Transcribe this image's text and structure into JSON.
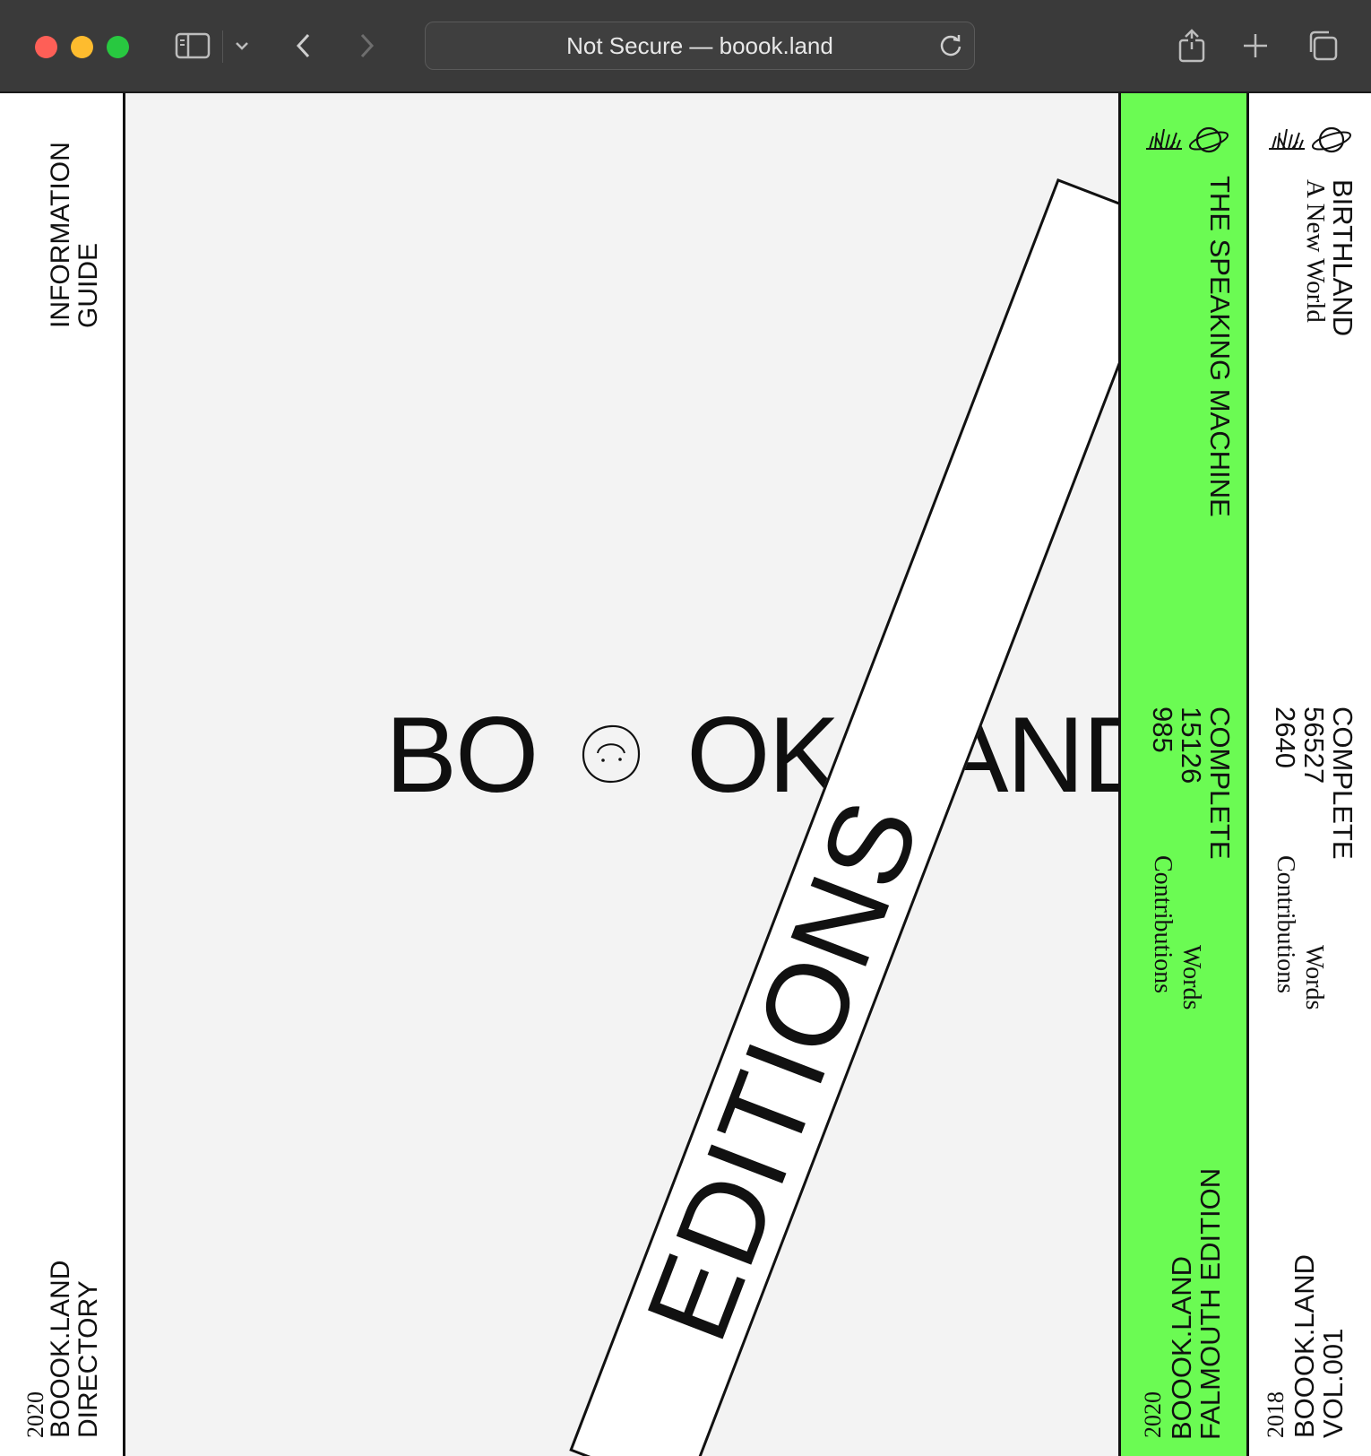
{
  "browser": {
    "url_text": "Not Secure — boook.land"
  },
  "left_panel": {
    "top_text": "INFORMATION\nGUIDE",
    "bottom_title": "BOOOK.LAND\nDIRECTORY",
    "bottom_year": "2020"
  },
  "center": {
    "logo_left": "BO",
    "logo_mid": "OK",
    "logo_right": "AND",
    "editions": "EDITIONS"
  },
  "spine_green": {
    "title": "THE SPEAKING MACHINE",
    "stats_heading": "COMPLETE",
    "words_count": "15126",
    "contributions_count": "985",
    "words_label": "Words",
    "contributions_label": "Contributions",
    "bottom_title": "BOOOK.LAND\nFALMOUTH EDITION",
    "bottom_year": "2020",
    "color": "#6bfb53"
  },
  "spine_white": {
    "title": "BIRTHLAND",
    "subtitle": "A New World",
    "stats_heading": "COMPLETE",
    "words_count": "56527",
    "contributions_count": "2640",
    "words_label": "Words",
    "contributions_label": "Contributions",
    "bottom_title": "BOOOK.LAND\nVOL.001",
    "bottom_year": "2018"
  }
}
